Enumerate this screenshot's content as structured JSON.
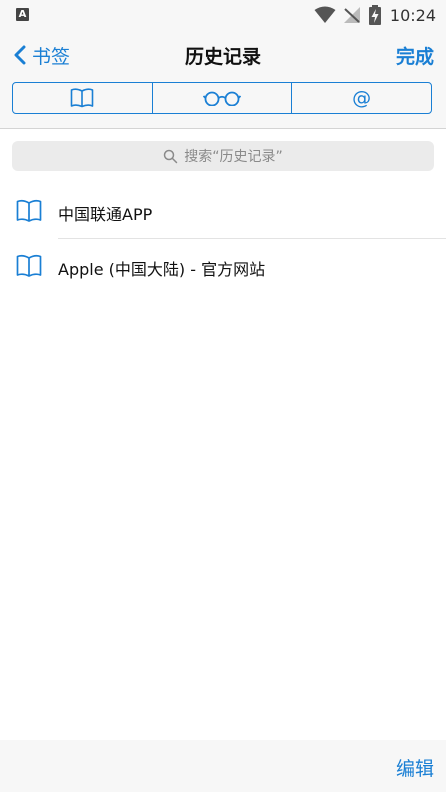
{
  "status_bar": {
    "app_badge": "A",
    "time": "10:24"
  },
  "nav": {
    "back_label": "书签",
    "title": "历史记录",
    "done_label": "完成"
  },
  "segments": [
    {
      "icon": "book-icon",
      "selected": false
    },
    {
      "icon": "glasses-icon",
      "selected": false
    },
    {
      "icon": "at-icon",
      "label": "@",
      "selected": false
    }
  ],
  "search": {
    "placeholder": "搜索“历史记录”"
  },
  "history_items": [
    {
      "icon": "book-icon",
      "title": "中国联通APP"
    },
    {
      "icon": "book-icon",
      "title": "Apple (中国大陆) - 官方网站"
    }
  ],
  "toolbar": {
    "edit_label": "编辑"
  },
  "colors": {
    "accent": "#1a7fd4",
    "bar_background": "#f7f7f7",
    "search_background": "#ebebeb"
  }
}
